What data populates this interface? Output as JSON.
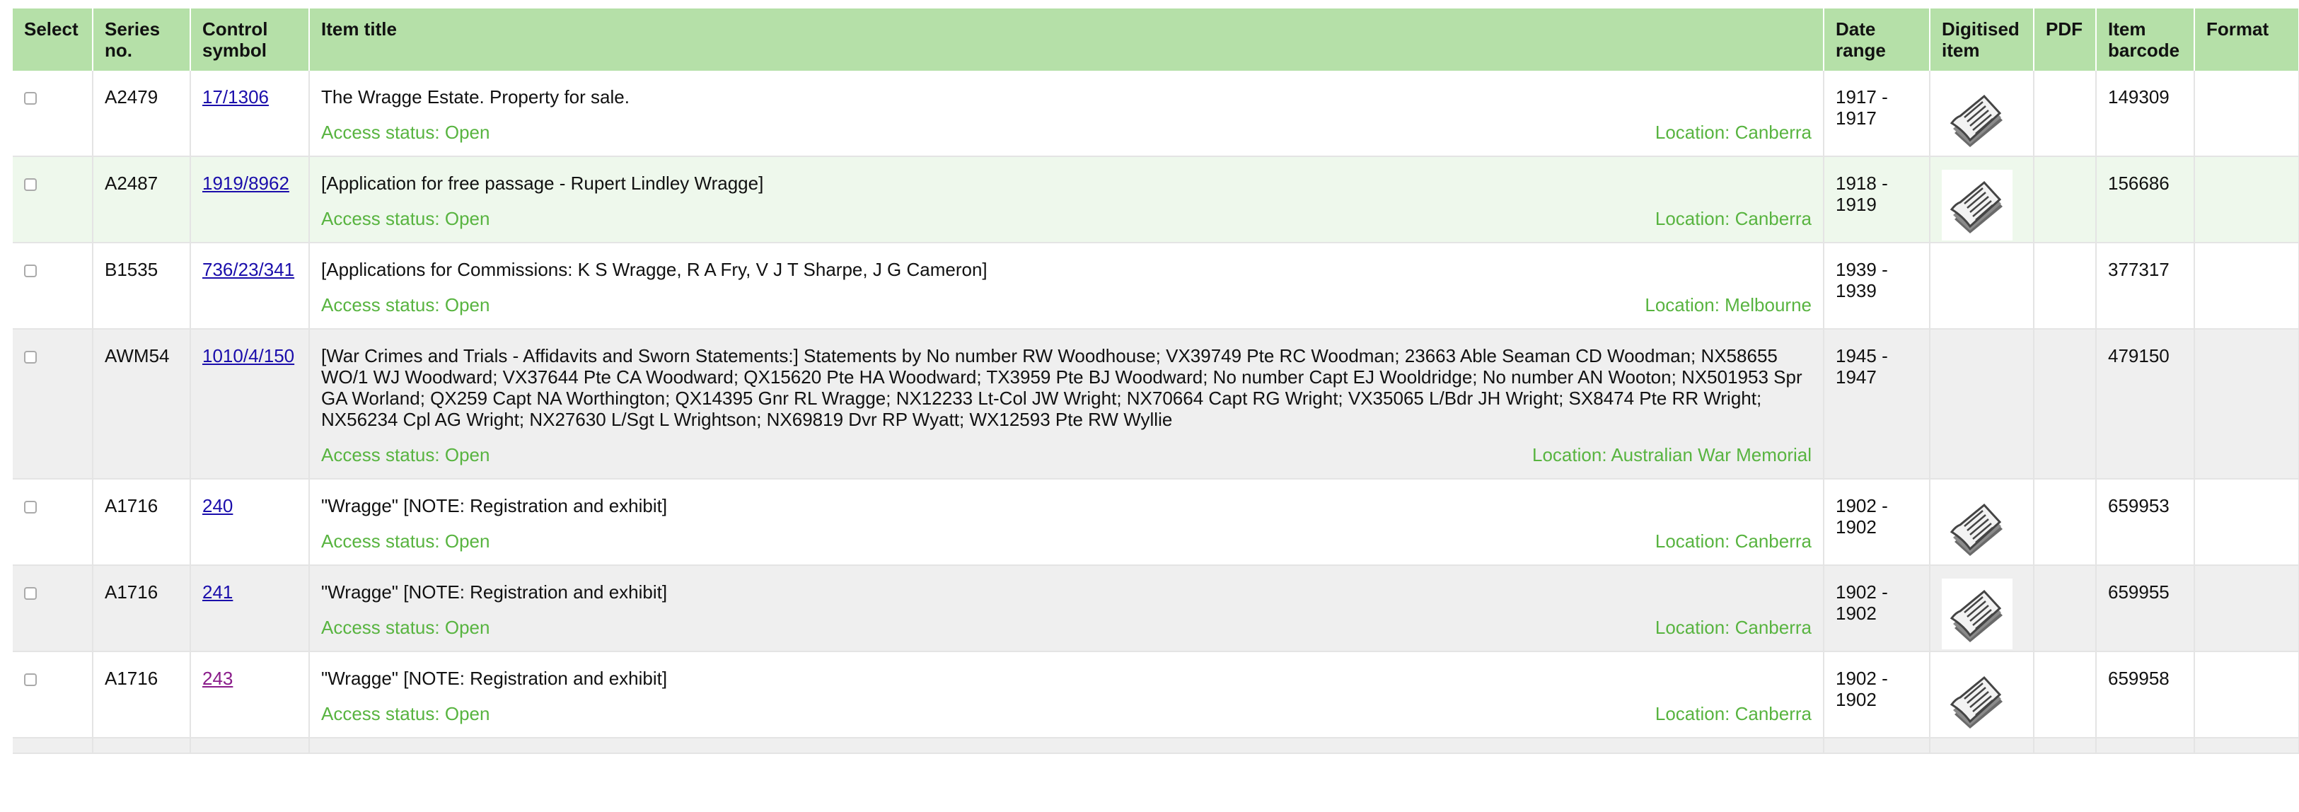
{
  "headers": {
    "select": "Select",
    "series_no": "Series no.",
    "control_symbol": "Control symbol",
    "item_title": "Item title",
    "date_range": "Date range",
    "digitised_item": "Digitised item",
    "pdf": "PDF",
    "item_barcode": "Item barcode",
    "format": "Format"
  },
  "colors": {
    "header_bg": "#b5e0a8",
    "access_text": "#58b440",
    "link": "#1a0dab",
    "visited_link": "#8a1c8a",
    "row_green": "#eef8ec",
    "row_grey": "#efefef"
  },
  "rows": [
    {
      "series": "A2479",
      "control": "17/1306",
      "title": "The Wragge Estate. Property for sale.",
      "access": "Access status: Open",
      "location": "Location: Canberra",
      "date_start": "1917 -",
      "date_end": "1917",
      "digitised": true,
      "barcode": "149309"
    },
    {
      "series": "A2487",
      "control": "1919/8962",
      "title": "[Application for free passage - Rupert Lindley Wragge]",
      "access": "Access status: Open",
      "location": "Location: Canberra",
      "date_start": "1918 -",
      "date_end": "1919",
      "digitised": true,
      "barcode": "156686"
    },
    {
      "series": "B1535",
      "control": "736/23/341",
      "title": "[Applications for Commissions: K S Wragge, R A Fry, V J T Sharpe, J G Cameron]",
      "access": "Access status: Open",
      "location": "Location: Melbourne",
      "date_start": "1939 -",
      "date_end": "1939",
      "digitised": false,
      "barcode": "377317"
    },
    {
      "series": "AWM54",
      "control": "1010/4/150",
      "title": "[War Crimes and Trials - Affidavits and Sworn Statements:] Statements by No number RW Woodhouse; VX39749 Pte RC Woodman; 23663 Able Seaman CD Woodman; NX58655 WO/1 WJ Woodward; VX37644 Pte CA Woodward; QX15620 Pte HA Woodward; TX3959 Pte BJ Woodward; No number Capt EJ Wooldridge; No number AN Wooton; NX501953 Spr GA Worland; QX259 Capt NA Worthington; QX14395 Gnr RL Wragge; NX12233 Lt-Col JW Wright; NX70664 Capt RG Wright; VX35065 L/Bdr JH Wright; SX8474 Pte RR Wright; NX56234 Cpl AG Wright; NX27630 L/Sgt L Wrightson; NX69819 Dvr RP Wyatt; WX12593 Pte RW Wyllie",
      "access": "Access status: Open",
      "location": "Location: Australian War Memorial",
      "date_start": "1945 -",
      "date_end": "1947",
      "digitised": false,
      "barcode": "479150"
    },
    {
      "series": "A1716",
      "control": "240",
      "title": "\"Wragge\" [NOTE: Registration and exhibit]",
      "access": "Access status: Open",
      "location": "Location: Canberra",
      "date_start": "1902 -",
      "date_end": "1902",
      "digitised": true,
      "barcode": "659953"
    },
    {
      "series": "A1716",
      "control": "241",
      "title": "\"Wragge\" [NOTE: Registration and exhibit]",
      "access": "Access status: Open",
      "location": "Location: Canberra",
      "date_start": "1902 -",
      "date_end": "1902",
      "digitised": true,
      "barcode": "659955"
    },
    {
      "series": "A1716",
      "control": "243",
      "title": "\"Wragge\" [NOTE: Registration and exhibit]",
      "access": "Access status: Open",
      "location": "Location: Canberra",
      "date_start": "1902 -",
      "date_end": "1902",
      "digitised": true,
      "barcode": "659958"
    }
  ]
}
